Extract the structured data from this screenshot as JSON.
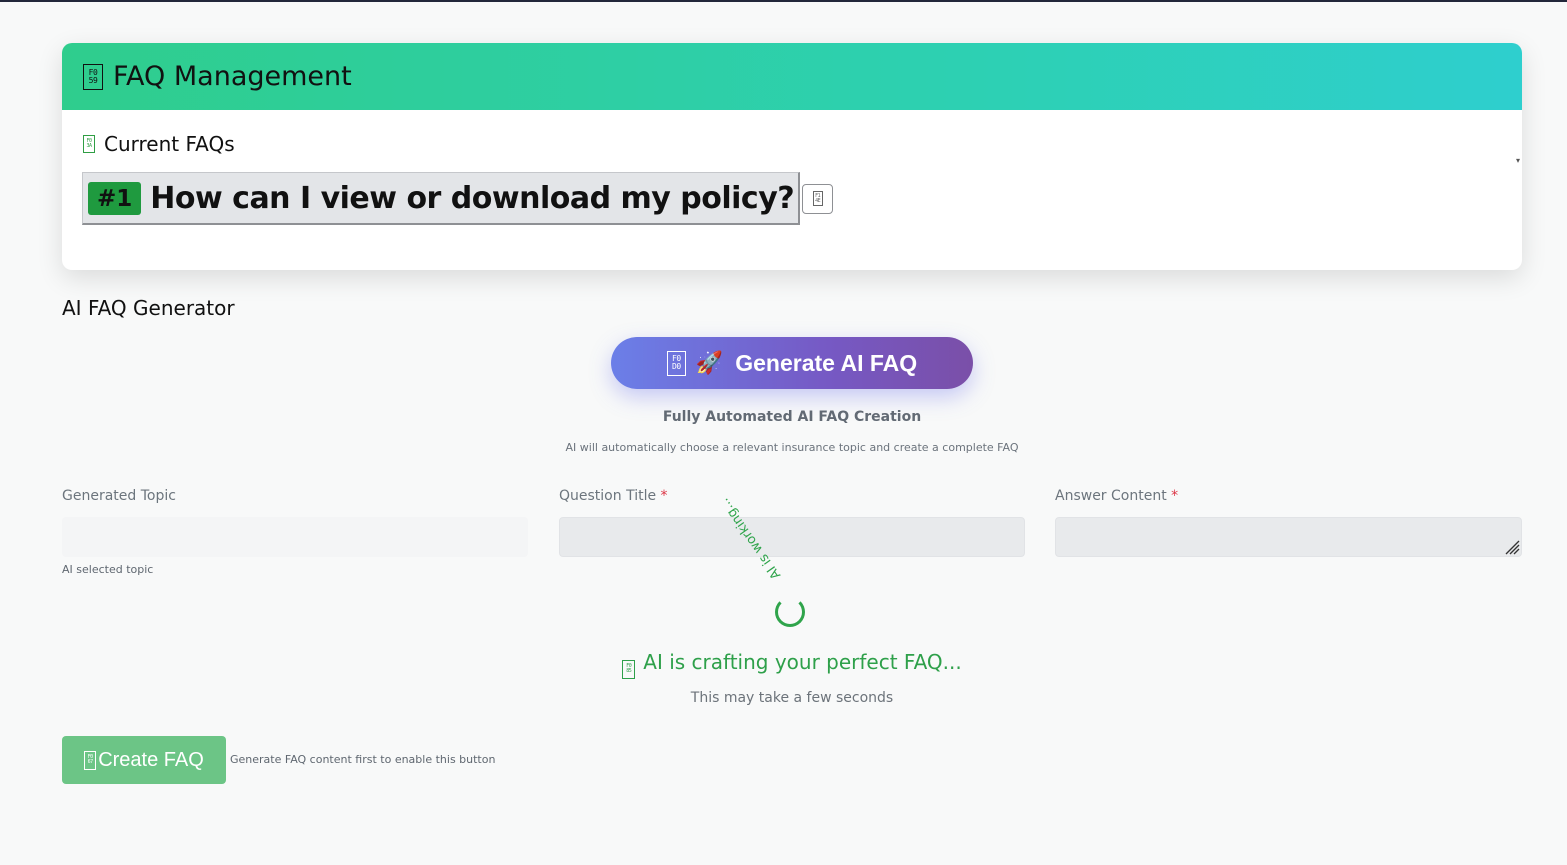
{
  "card": {
    "title": "FAQ Management",
    "title_icon_code": [
      "F0",
      "59"
    ],
    "current_label": "Current FAQs",
    "current_icon_code": [
      "F0",
      "3A"
    ],
    "dropdown_caret": "▾"
  },
  "faqs": [
    {
      "number": "#1",
      "question": "How can I view or download my policy?",
      "edit_icon_code": [
        "F1",
        "4E"
      ]
    }
  ],
  "generator": {
    "section_title": "AI FAQ Generator",
    "button_label": "Generate AI FAQ",
    "button_icon_code": [
      "F0",
      "D0"
    ],
    "button_emoji": "🚀",
    "auto_title": "Fully Automated AI FAQ Creation",
    "auto_subtitle": "AI will automatically choose a relevant insurance topic and create a complete FAQ"
  },
  "fields": {
    "topic_label": "Generated Topic",
    "topic_value": "",
    "topic_hint": "AI selected topic",
    "question_label": "Question Title",
    "question_value": "",
    "answer_label": "Answer Content",
    "answer_value": "",
    "required_marker": "*"
  },
  "loading": {
    "spinner_text": "AI is working...",
    "message": "AI is crafting your perfect FAQ...",
    "message_icon_code": [
      "F0",
      "85"
    ],
    "submessage": "This may take a few seconds"
  },
  "create": {
    "button_label": "Create FAQ",
    "button_icon_code": [
      "F0",
      "67"
    ],
    "hint": "Generate FAQ content first to enable this button"
  },
  "colors": {
    "header_gradient_start": "#2fcd8d",
    "header_gradient_end": "#2ecfce",
    "generate_gradient_start": "#6b7fe8",
    "generate_gradient_end": "#7a4fa8",
    "success_green": "#2ea04a",
    "create_button_bg": "#6cc586",
    "required_red": "#dc3545"
  }
}
